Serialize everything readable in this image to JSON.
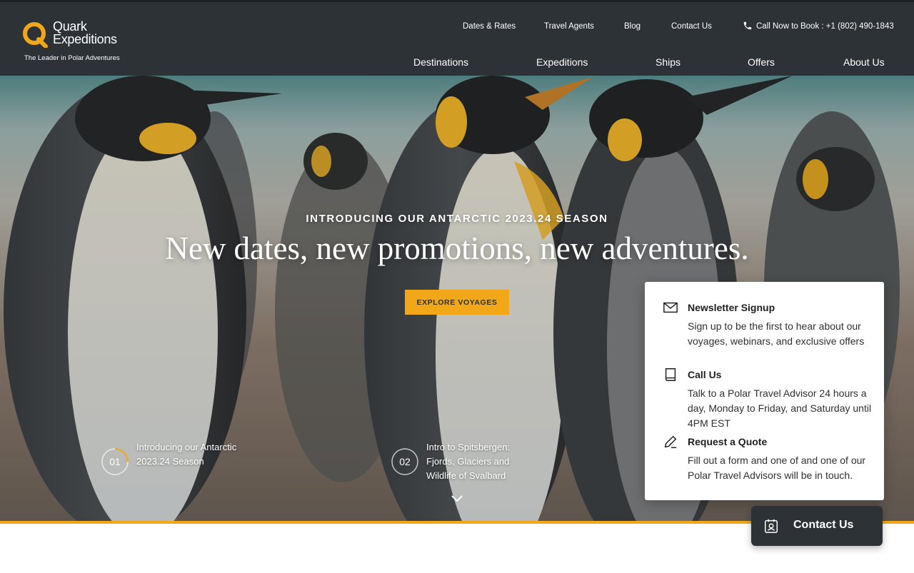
{
  "brand": {
    "name_line1": "Quark",
    "name_line2": "Expeditions",
    "tagline": "The Leader in Polar Adventures",
    "accent_color": "#f1a718",
    "header_color": "#2c3236"
  },
  "utility_nav": {
    "items": [
      "Dates & Rates",
      "Travel Agents",
      "Blog",
      "Contact Us"
    ],
    "phone": "Call Now to Book : +1 (802) 490-1843",
    "phone_icon": "phone-icon"
  },
  "main_nav": {
    "items": [
      "Destinations",
      "Expeditions",
      "Ships",
      "Offers",
      "About Us"
    ]
  },
  "hero": {
    "eyebrow": "INTRODUCING OUR ANTARCTIC 2023.24 SEASON",
    "headline": "New dates, new promotions, new adventures.",
    "cta_label": "EXPLORE VOYAGES",
    "slides": [
      {
        "number": "01",
        "text": "Introducing our Antarctic 2023.24 Season",
        "active": true
      },
      {
        "number": "02",
        "text": "Intro to Spitsbergen: Fjords, Glaciers and Wildlife of Svalbard",
        "active": false
      }
    ],
    "scroll_icon": "chevron-down-icon"
  },
  "contact_panel": {
    "items": [
      {
        "icon": "mail-icon",
        "title": "Newsletter Signup",
        "text": "Sign up to be the first to hear about our voyages, webinars, and exclusive offers"
      },
      {
        "icon": "book-icon",
        "title": "Call Us",
        "text": "Talk to a Polar Travel Advisor 24 hours a day, Monday to Friday, and Saturday until 4PM EST"
      },
      {
        "icon": "pencil-icon",
        "title": "Request a Quote",
        "text": "Fill out a form and one of and one of our Polar Travel Advisors will be in touch."
      }
    ]
  },
  "contact_button": {
    "label": "Contact Us",
    "icon": "contact-card-icon"
  }
}
